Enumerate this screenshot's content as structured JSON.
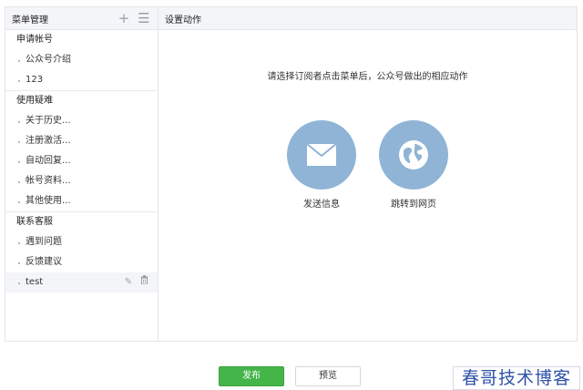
{
  "sidebar": {
    "title": "菜单管理",
    "add_icon": "plus-icon",
    "sort_icon": "list-icon",
    "groups": [
      {
        "title": "申请帐号",
        "items": [
          "公众号介绍",
          "123"
        ]
      },
      {
        "title": "使用疑难",
        "items": [
          "关于历史...",
          "注册激活...",
          "自动回复...",
          "帐号资料...",
          "其他使用..."
        ]
      },
      {
        "title": "联系客服",
        "items": [
          "遇到问题",
          "反馈建议",
          "test"
        ]
      }
    ],
    "active_item": "test",
    "row_icons": [
      "pencil-icon",
      "trash-icon"
    ]
  },
  "main": {
    "title": "设置动作",
    "prompt": "请选择订阅者点击菜单后，公众号做出的相应动作",
    "actions": [
      {
        "label": "发送信息",
        "icon": "envelope-icon"
      },
      {
        "label": "跳转到网页",
        "icon": "globe-icon"
      }
    ],
    "action_color": "#8fb4d6"
  },
  "footer": {
    "publish_label": "发布",
    "preview_label": "预览",
    "publish_color": "#44b549"
  },
  "watermark": {
    "text": "春哥技术博客"
  }
}
